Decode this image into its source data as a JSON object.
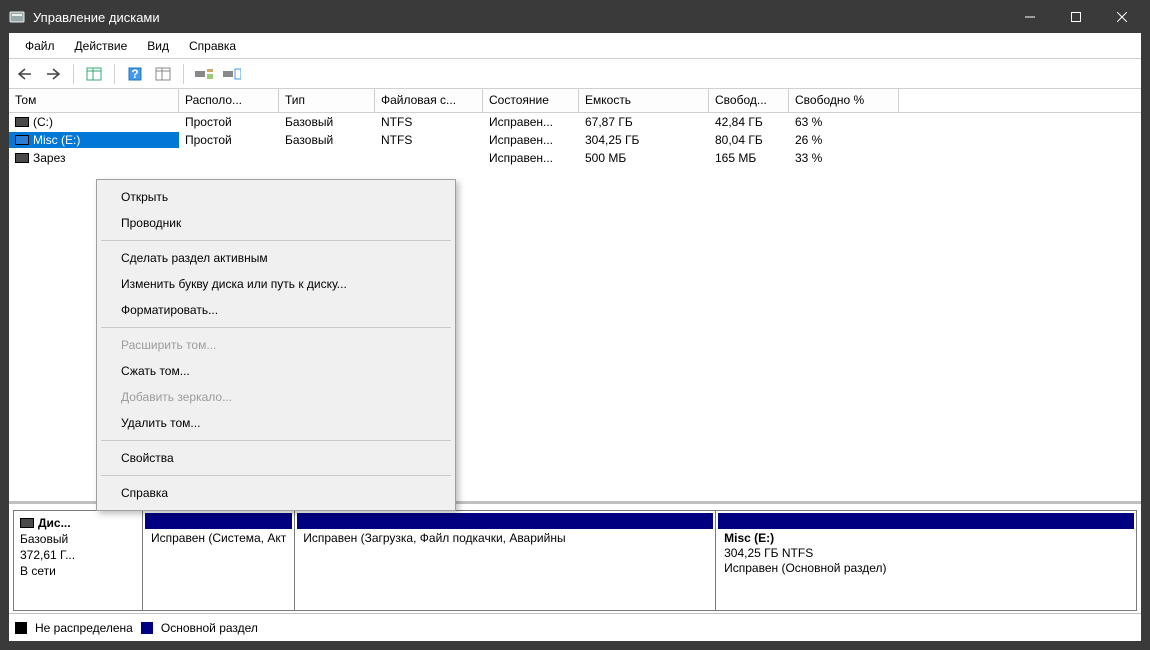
{
  "window": {
    "title": "Управление дисками"
  },
  "menu": {
    "items": [
      "Файл",
      "Действие",
      "Вид",
      "Справка"
    ]
  },
  "list": {
    "headers": [
      "Том",
      "Располо...",
      "Тип",
      "Файловая с...",
      "Состояние",
      "Емкость",
      "Свобод...",
      "Свободно %"
    ],
    "rows": [
      {
        "vol": "(C:)",
        "layout": "Простой",
        "type": "Базовый",
        "fs": "NTFS",
        "status": "Исправен...",
        "cap": "67,87 ГБ",
        "free": "42,84 ГБ",
        "pct": "63 %",
        "sel": false
      },
      {
        "vol": "Misc (E:)",
        "layout": "Простой",
        "type": "Базовый",
        "fs": "NTFS",
        "status": "Исправен...",
        "cap": "304,25 ГБ",
        "free": "80,04 ГБ",
        "pct": "26 %",
        "sel": true
      },
      {
        "vol": "Зарез",
        "layout": "",
        "type": "",
        "fs": "",
        "status": "Исправен...",
        "cap": "500 МБ",
        "free": "165 МБ",
        "pct": "33 %",
        "sel": false
      }
    ]
  },
  "disk": {
    "label": "Дис...",
    "type": "Базовый",
    "size": "372,61 Г...",
    "state": "В сети",
    "partitions": [
      {
        "title": "",
        "line2": "",
        "status": "Исправен (Система, Акт",
        "wide": false
      },
      {
        "title": "",
        "line2": "",
        "status": "Исправен (Загрузка, Файл подкачки, Аварийны",
        "wide": true
      },
      {
        "title": "Misc  (E:)",
        "line2": "304,25 ГБ NTFS",
        "status": "Исправен (Основной раздел)",
        "wide": true
      }
    ]
  },
  "legend": {
    "unalloc": "Не распределена",
    "primary": "Основной раздел"
  },
  "context": {
    "items": [
      {
        "label": "Открыть",
        "disabled": false
      },
      {
        "label": "Проводник",
        "disabled": false
      },
      {
        "sep": true
      },
      {
        "label": "Сделать раздел активным",
        "disabled": false
      },
      {
        "label": "Изменить букву диска или путь к диску...",
        "disabled": false
      },
      {
        "label": "Форматировать...",
        "disabled": false
      },
      {
        "sep": true
      },
      {
        "label": "Расширить том...",
        "disabled": true
      },
      {
        "label": "Сжать том...",
        "disabled": false
      },
      {
        "label": "Добавить зеркало...",
        "disabled": true
      },
      {
        "label": "Удалить том...",
        "disabled": false
      },
      {
        "sep": true
      },
      {
        "label": "Свойства",
        "disabled": false
      },
      {
        "sep": true
      },
      {
        "label": "Справка",
        "disabled": false
      }
    ]
  }
}
